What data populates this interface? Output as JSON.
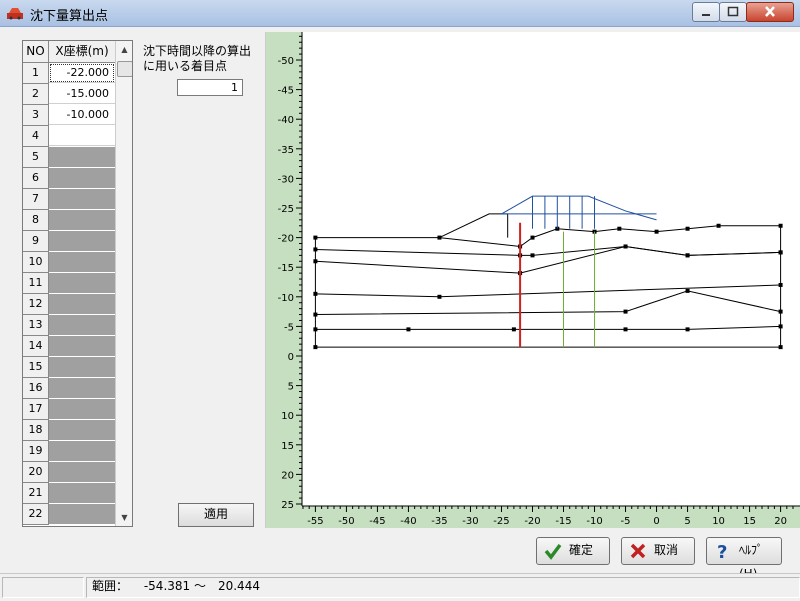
{
  "window": {
    "title": "沈下量算出点"
  },
  "grid": {
    "headers": [
      "NO",
      "X座標(m)"
    ],
    "rows": [
      {
        "no": "1",
        "x": "-22.000"
      },
      {
        "no": "2",
        "x": "-15.000"
      },
      {
        "no": "3",
        "x": "-10.000"
      },
      {
        "no": "4",
        "x": ""
      },
      {
        "no": "5",
        "x": ""
      },
      {
        "no": "6",
        "x": ""
      },
      {
        "no": "7",
        "x": ""
      },
      {
        "no": "8",
        "x": ""
      },
      {
        "no": "9",
        "x": ""
      },
      {
        "no": "10",
        "x": ""
      },
      {
        "no": "11",
        "x": ""
      },
      {
        "no": "12",
        "x": ""
      },
      {
        "no": "13",
        "x": ""
      },
      {
        "no": "14",
        "x": ""
      },
      {
        "no": "15",
        "x": ""
      },
      {
        "no": "16",
        "x": ""
      },
      {
        "no": "17",
        "x": ""
      },
      {
        "no": "18",
        "x": ""
      },
      {
        "no": "19",
        "x": ""
      },
      {
        "no": "20",
        "x": ""
      },
      {
        "no": "21",
        "x": ""
      },
      {
        "no": "22",
        "x": ""
      }
    ]
  },
  "settings": {
    "label": "沈下時間以降の算出に用いる着目点",
    "value": "1",
    "apply_label": "適用"
  },
  "plot": {
    "x_ticks": [
      -55,
      -50,
      -45,
      -40,
      -35,
      -30,
      -25,
      -20,
      -15,
      -10,
      -5,
      0,
      5,
      10,
      15,
      20
    ],
    "y_ticks": [
      -50,
      -45,
      -40,
      -35,
      -30,
      -25,
      -20,
      -15,
      -10,
      -5,
      0,
      5,
      10,
      15,
      20,
      25
    ],
    "colors": {
      "ruler": "#c5dfc0",
      "section": "#000000",
      "embankment": "#2050a0",
      "selected": "#d02020",
      "points": "#70b030"
    },
    "layers": [
      [
        [
          -55,
          20.0
        ],
        [
          -35,
          20.0
        ],
        [
          -22,
          18.5
        ],
        [
          -20,
          20.0
        ],
        [
          -16,
          21.5
        ],
        [
          -10,
          21.0
        ],
        [
          -6,
          21.5
        ],
        [
          0,
          21.0
        ],
        [
          5,
          21.5
        ],
        [
          10,
          22.0
        ],
        [
          20,
          22.0
        ]
      ],
      [
        [
          -55,
          18.0
        ],
        [
          -22,
          17.0
        ],
        [
          -20,
          17.0
        ],
        [
          -5,
          18.5
        ],
        [
          5,
          17.0
        ],
        [
          20,
          17.5
        ]
      ],
      [
        [
          -55,
          16.0
        ],
        [
          -22,
          14.0
        ],
        [
          -5,
          18.5
        ],
        [
          5,
          17.0
        ],
        [
          20,
          17.5
        ]
      ],
      [
        [
          -55,
          10.5
        ],
        [
          -35,
          10.0
        ],
        [
          20,
          12.0
        ]
      ],
      [
        [
          -55,
          7.0
        ],
        [
          -5,
          7.5
        ],
        [
          5,
          11.0
        ],
        [
          20,
          7.5
        ]
      ],
      [
        [
          -55,
          4.5
        ],
        [
          -40,
          4.5
        ],
        [
          -23,
          4.5
        ],
        [
          -5,
          4.5
        ],
        [
          5,
          4.5
        ],
        [
          20,
          5.0
        ]
      ],
      [
        [
          -55,
          1.5
        ],
        [
          20,
          1.5
        ]
      ]
    ],
    "embankment": [
      [
        -25,
        24.0
      ],
      [
        -20,
        27.0
      ],
      [
        -11,
        27.0
      ],
      [
        -5,
        24.5
      ],
      [
        0,
        23.0
      ]
    ],
    "embankment_posts": [
      -20,
      -18,
      -16,
      -14,
      -12,
      -10
    ],
    "embankment_berm": [
      [
        -35,
        20.0
      ],
      [
        -27,
        24.0
      ],
      [
        -24,
        24.0
      ],
      [
        -24,
        20.0
      ]
    ],
    "target_selected": -22.0,
    "targets": [
      -15.0,
      -10.0
    ],
    "x_range": [
      -57,
      22
    ],
    "y_range": [
      -54,
      25
    ]
  },
  "buttons": {
    "ok": "確定",
    "cancel": "取消",
    "help": "ﾍﾙﾌﾟ(H)"
  },
  "status": {
    "range_label": "範囲：",
    "range_value": "-54.381 ～　20.444"
  }
}
